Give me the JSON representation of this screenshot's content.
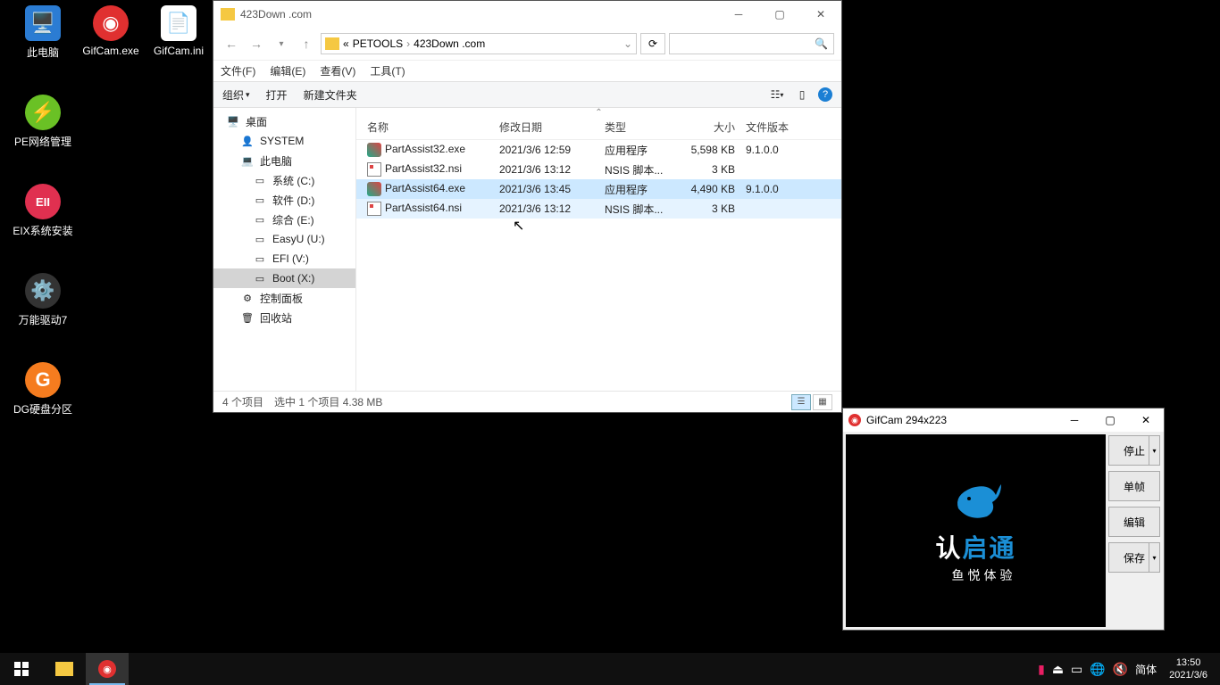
{
  "desktop": {
    "icons": [
      {
        "label": "此电脑"
      },
      {
        "label": "GifCam.exe"
      },
      {
        "label": "GifCam.ini"
      },
      {
        "label": "PE网络管理"
      },
      {
        "label": "EIX系统安装"
      },
      {
        "label": "万能驱动7"
      },
      {
        "label": "DG硬盘分区"
      }
    ]
  },
  "explorer": {
    "title": "423Down .com",
    "breadcrumb": {
      "prefix": "«",
      "parts": [
        "PETOOLS",
        "423Down .com"
      ]
    },
    "menu": {
      "file": "文件(F)",
      "edit": "编辑(E)",
      "view": "查看(V)",
      "tools": "工具(T)"
    },
    "toolbar": {
      "org": "组织",
      "open": "打开",
      "newfolder": "新建文件夹"
    },
    "sidebar": [
      {
        "label": "桌面",
        "icon": "desktop",
        "indent": 0
      },
      {
        "label": "SYSTEM",
        "icon": "user",
        "indent": 1
      },
      {
        "label": "此电脑",
        "icon": "pc",
        "indent": 1
      },
      {
        "label": "系统 (C:)",
        "icon": "drive",
        "indent": 2
      },
      {
        "label": "软件 (D:)",
        "icon": "drive",
        "indent": 2
      },
      {
        "label": "综合 (E:)",
        "icon": "drive",
        "indent": 2
      },
      {
        "label": "EasyU (U:)",
        "icon": "drive",
        "indent": 2
      },
      {
        "label": "EFI (V:)",
        "icon": "drive",
        "indent": 2
      },
      {
        "label": "Boot (X:)",
        "icon": "drive",
        "indent": 2,
        "sel": true
      },
      {
        "label": "控制面板",
        "icon": "cp",
        "indent": 1
      },
      {
        "label": "回收站",
        "icon": "bin",
        "indent": 1
      }
    ],
    "columns": {
      "name": "名称",
      "date": "修改日期",
      "type": "类型",
      "size": "大小",
      "ver": "文件版本"
    },
    "files": [
      {
        "name": "PartAssist32.exe",
        "date": "2021/3/6 12:59",
        "type": "应用程序",
        "size": "5,598 KB",
        "ver": "9.1.0.0",
        "ico": "exe"
      },
      {
        "name": "PartAssist32.nsi",
        "date": "2021/3/6 13:12",
        "type": "NSIS 脚本...",
        "size": "3 KB",
        "ver": "",
        "ico": "nsi"
      },
      {
        "name": "PartAssist64.exe",
        "date": "2021/3/6 13:45",
        "type": "应用程序",
        "size": "4,490 KB",
        "ver": "9.1.0.0",
        "ico": "exe",
        "state": "selected"
      },
      {
        "name": "PartAssist64.nsi",
        "date": "2021/3/6 13:12",
        "type": "NSIS 脚本...",
        "size": "3 KB",
        "ver": "",
        "ico": "nsi",
        "state": "hover"
      }
    ],
    "status": {
      "count": "4 个项目",
      "sel": "选中 1 个项目  4.38 MB"
    }
  },
  "gifcam": {
    "title": "GifCam 294x223",
    "buttons": {
      "stop": "停止",
      "frame": "单帧",
      "edit": "编辑",
      "save": "保存"
    },
    "logo": {
      "line1a": "认",
      "line1b": "启通",
      "line2": "鱼悦体验"
    }
  },
  "taskbar": {
    "ime": "简体",
    "time": "13:50",
    "date": "2021/3/6"
  }
}
